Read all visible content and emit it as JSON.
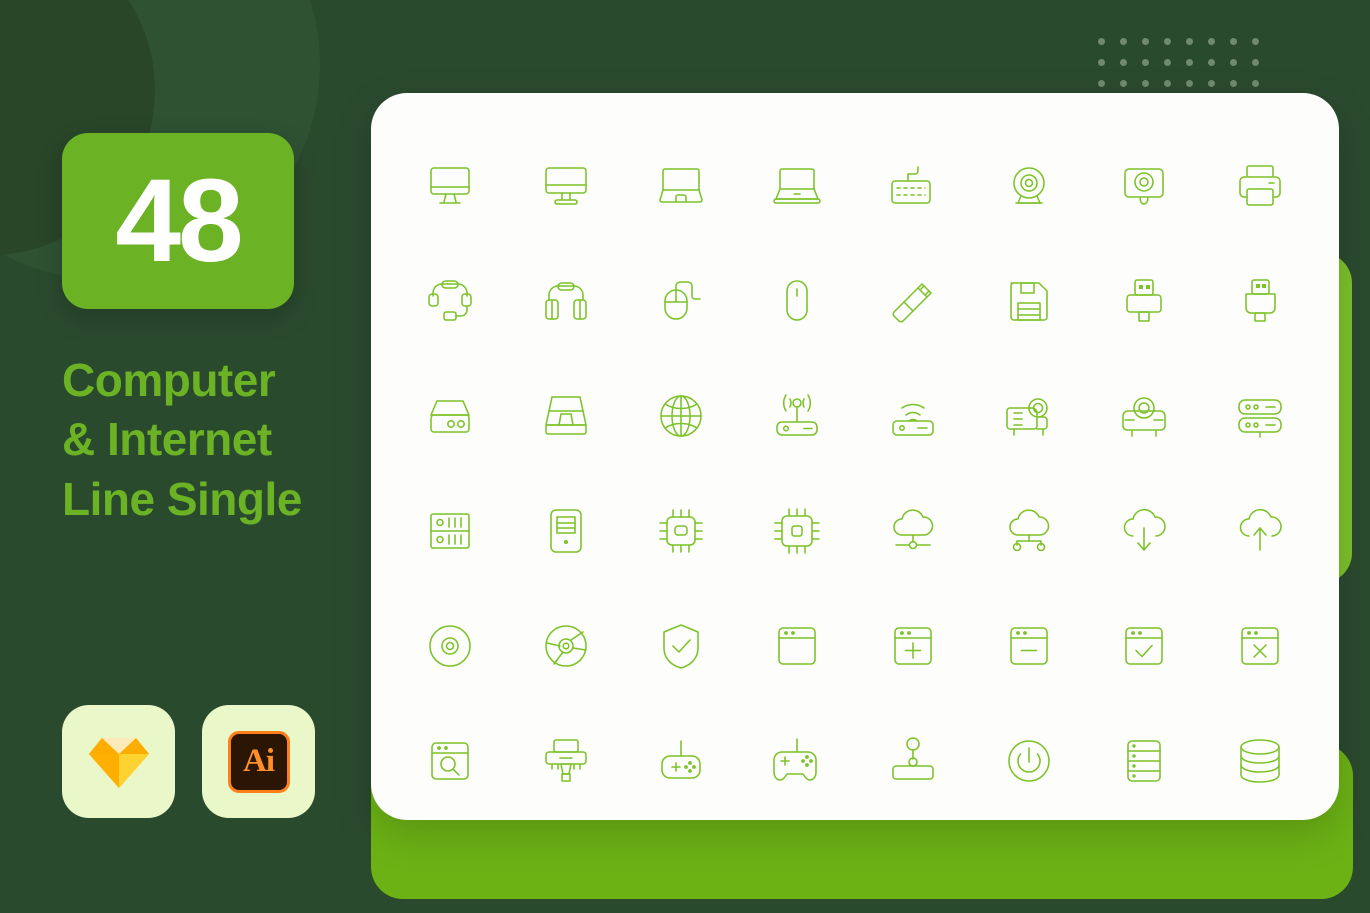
{
  "poster": {
    "count": "48",
    "title_lines": [
      "Computer",
      "& Internet",
      "Line Single"
    ],
    "colors": {
      "background": "#2a4a2e",
      "accent_green": "#6cb225",
      "icon_green": "#7cc229",
      "badge_bg": "#e9f7c9",
      "card_white": "#fdfdfb"
    }
  },
  "app_badges": [
    {
      "name": "sketch",
      "label": ""
    },
    {
      "name": "illustrator",
      "label": "Ai"
    }
  ],
  "icons": [
    {
      "name": "imac-icon",
      "label": "iMac"
    },
    {
      "name": "desktop-monitor-icon",
      "label": "Desktop Monitor"
    },
    {
      "name": "laptop-open-icon",
      "label": "Laptop"
    },
    {
      "name": "laptop-icon",
      "label": "Notebook"
    },
    {
      "name": "keyboard-icon",
      "label": "Keyboard"
    },
    {
      "name": "webcam-icon",
      "label": "Webcam"
    },
    {
      "name": "security-camera-icon",
      "label": "Security Camera"
    },
    {
      "name": "printer-icon",
      "label": "Printer"
    },
    {
      "name": "headset-icon",
      "label": "Headset"
    },
    {
      "name": "headphones-icon",
      "label": "Headphones"
    },
    {
      "name": "wired-mouse-icon",
      "label": "Wired Mouse"
    },
    {
      "name": "wireless-mouse-icon",
      "label": "Wireless Mouse"
    },
    {
      "name": "usb-flash-drive-icon",
      "label": "USB Flash Drive"
    },
    {
      "name": "floppy-disk-icon",
      "label": "Floppy Disk"
    },
    {
      "name": "usb-connector-icon",
      "label": "USB Connector"
    },
    {
      "name": "usb-cable-icon",
      "label": "USB Cable"
    },
    {
      "name": "external-drive-icon",
      "label": "External Hard Drive"
    },
    {
      "name": "scanner-icon",
      "label": "Scanner"
    },
    {
      "name": "globe-icon",
      "label": "Internet Globe"
    },
    {
      "name": "wifi-router-icon",
      "label": "Wi-Fi Router"
    },
    {
      "name": "wifi-modem-icon",
      "label": "Wi-Fi Modem"
    },
    {
      "name": "projector-icon",
      "label": "Projector"
    },
    {
      "name": "projector-alt-icon",
      "label": "Projector Front"
    },
    {
      "name": "server-rack-icon",
      "label": "Server Rack"
    },
    {
      "name": "server-unit-icon",
      "label": "Server Unit"
    },
    {
      "name": "computer-tower-icon",
      "label": "Computer Tower"
    },
    {
      "name": "cpu-chip-icon",
      "label": "CPU Chip"
    },
    {
      "name": "processor-icon",
      "label": "Processor"
    },
    {
      "name": "cloud-network-icon",
      "label": "Cloud Network"
    },
    {
      "name": "cloud-sharing-icon",
      "label": "Cloud Sharing"
    },
    {
      "name": "cloud-download-icon",
      "label": "Cloud Download"
    },
    {
      "name": "cloud-upload-icon",
      "label": "Cloud Upload"
    },
    {
      "name": "disc-icon",
      "label": "Disc"
    },
    {
      "name": "cd-rom-icon",
      "label": "CD-ROM"
    },
    {
      "name": "shield-check-icon",
      "label": "Security Shield"
    },
    {
      "name": "browser-window-icon",
      "label": "Browser Window"
    },
    {
      "name": "browser-add-icon",
      "label": "Browser Add"
    },
    {
      "name": "browser-remove-icon",
      "label": "Browser Remove"
    },
    {
      "name": "browser-check-icon",
      "label": "Browser Check"
    },
    {
      "name": "browser-close-icon",
      "label": "Browser Close"
    },
    {
      "name": "browser-search-icon",
      "label": "Browser Search"
    },
    {
      "name": "vga-connector-icon",
      "label": "VGA Connector"
    },
    {
      "name": "gamepad-icon",
      "label": "Gamepad"
    },
    {
      "name": "game-controller-icon",
      "label": "Game Controller"
    },
    {
      "name": "joystick-icon",
      "label": "Joystick"
    },
    {
      "name": "power-button-icon",
      "label": "Power Button"
    },
    {
      "name": "server-stack-icon",
      "label": "Server Stack"
    },
    {
      "name": "database-icon",
      "label": "Database"
    }
  ],
  "decor": {
    "dot_grid_columns": 8,
    "dot_grid_rows": 3
  }
}
